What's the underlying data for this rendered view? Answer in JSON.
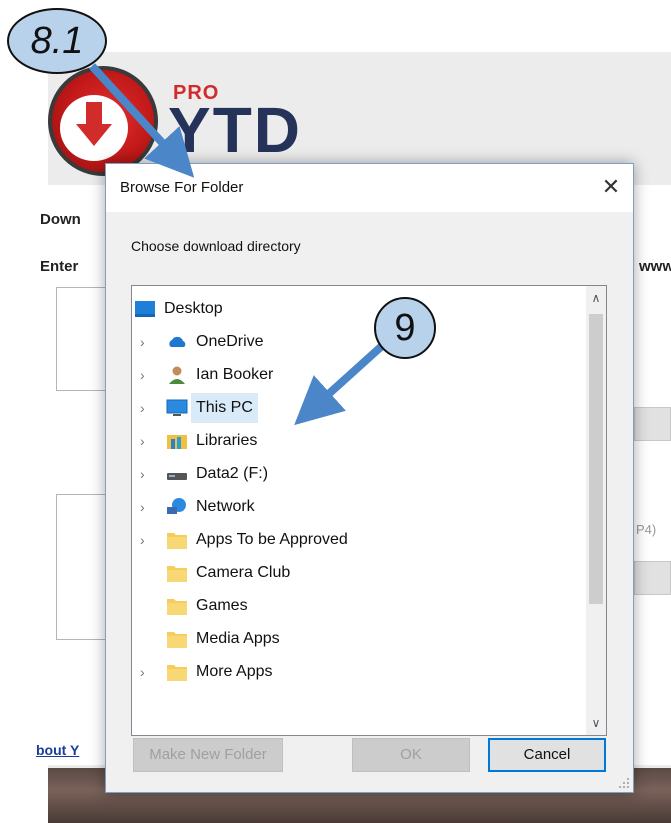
{
  "background_app": {
    "logo_pro": "PRO",
    "logo_name": "YTD",
    "label_download": "Down",
    "label_enter": "Enter",
    "right_fragment_url": "www",
    "right_fragment_format": "P4)",
    "link_fragment": "bout Y"
  },
  "dialog": {
    "title": "Browse For Folder",
    "close_glyph": "✕",
    "prompt": "Choose download directory",
    "tree": [
      {
        "label": "Desktop",
        "icon": "desktop-icon",
        "expander": false,
        "level": 0
      },
      {
        "label": "OneDrive",
        "icon": "onedrive-cloud-icon",
        "expander": true,
        "level": 1
      },
      {
        "label": "Ian Booker",
        "icon": "user-icon",
        "expander": true,
        "level": 1
      },
      {
        "label": "This PC",
        "icon": "computer-icon",
        "expander": true,
        "level": 1,
        "selected": true
      },
      {
        "label": "Libraries",
        "icon": "libraries-icon",
        "expander": true,
        "level": 1
      },
      {
        "label": "Data2 (F:)",
        "icon": "drive-icon",
        "expander": true,
        "level": 1
      },
      {
        "label": "Network",
        "icon": "network-icon",
        "expander": true,
        "level": 1
      },
      {
        "label": "Apps To be Approved",
        "icon": "folder-icon",
        "expander": true,
        "level": 1
      },
      {
        "label": "Camera Club",
        "icon": "folder-icon",
        "expander": false,
        "level": 1
      },
      {
        "label": "Games",
        "icon": "folder-icon",
        "expander": false,
        "level": 1
      },
      {
        "label": "Media Apps",
        "icon": "folder-icon",
        "expander": false,
        "level": 1
      },
      {
        "label": "More Apps",
        "icon": "folder-icon",
        "expander": true,
        "level": 1
      }
    ],
    "buttons": {
      "make_new_folder": "Make New Folder",
      "ok": "OK",
      "cancel": "Cancel"
    }
  },
  "annotations": {
    "step_a": "8.1",
    "step_b": "9"
  },
  "colors": {
    "selection": "#d9ebf9",
    "callout_fill": "#b9d2ec",
    "arrow": "#4a86c8",
    "logo_red": "#d22b2b",
    "logo_navy": "#25325a"
  }
}
